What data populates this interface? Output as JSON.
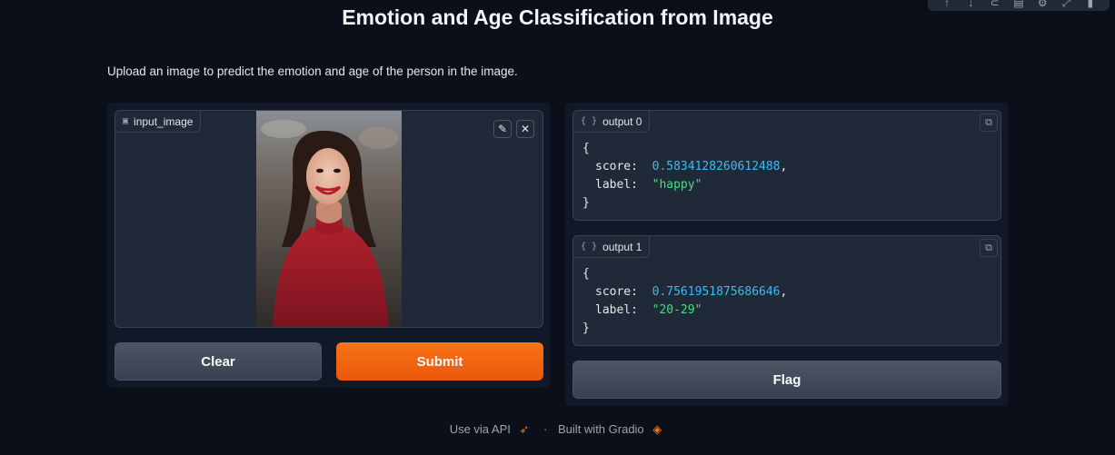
{
  "toolbar": {
    "icons": [
      "arrow-up-icon",
      "arrow-down-icon",
      "link-icon",
      "comment-icon",
      "gear-icon",
      "expand-icon",
      "trash-icon"
    ]
  },
  "page": {
    "title": "Emotion and Age Classification from Image",
    "description": "Upload an image to predict the emotion and age of the person in the image."
  },
  "input": {
    "label": "input_image",
    "clear_label": "Clear",
    "submit_label": "Submit"
  },
  "outputs": [
    {
      "label": "output 0",
      "open": "{",
      "score_key": "score:",
      "score": "0.5834128260612488",
      "label_key": "label:",
      "label_value": "\"happy\"",
      "close": "}"
    },
    {
      "label": "output 1",
      "open": "{",
      "score_key": "score:",
      "score": "0.7561951875686646",
      "label_key": "label:",
      "label_value": "\"20-29\"",
      "close": "}"
    }
  ],
  "flag_label": "Flag",
  "footer": {
    "api_link": "Use via API",
    "separator": "·",
    "built_with": "Built with Gradio"
  },
  "colors": {
    "background": "#0b0f19",
    "accent": "#f97316",
    "number": "#38bdf8",
    "string": "#4ade80"
  }
}
